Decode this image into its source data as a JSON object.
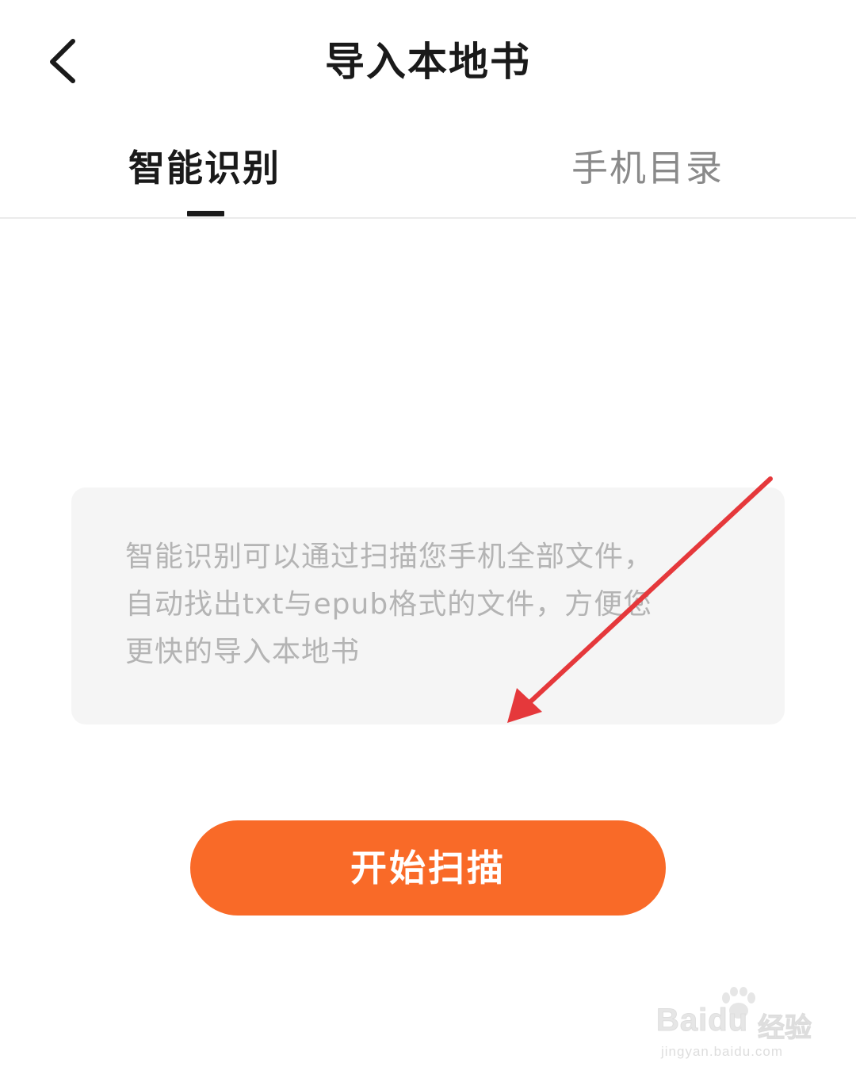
{
  "header": {
    "title": "导入本地书",
    "back_icon": "chevron-left-icon"
  },
  "tabs": [
    {
      "label": "智能识别",
      "active": true
    },
    {
      "label": "手机目录",
      "active": false
    }
  ],
  "info": {
    "lines": [
      "智能识别可以通过扫描您手机全部文件，",
      "自动找出txt与epub格式的文件，方便您",
      "更快的导入本地书"
    ]
  },
  "actions": {
    "start_scan_label": "开始扫描"
  },
  "annotation": {
    "arrow_color": "#e5383b"
  },
  "watermark": {
    "brand": "Baidu",
    "suffix": "经验",
    "url": "jingyan.baidu.com"
  },
  "colors": {
    "accent": "#f96a28",
    "active_tab": "#1a1a1a",
    "inactive_tab": "#8a8a8a",
    "info_text": "#b4b4b4",
    "info_bg": "#f5f5f5"
  }
}
